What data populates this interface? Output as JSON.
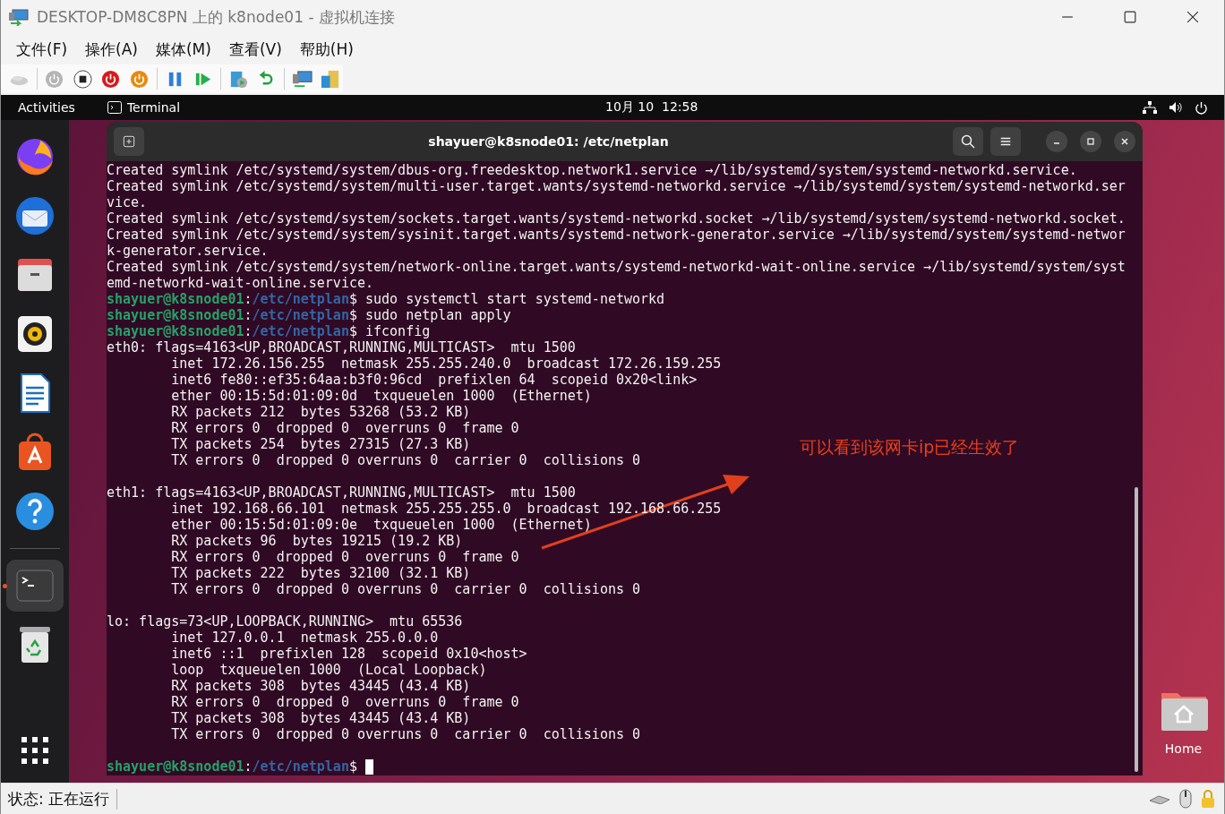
{
  "window": {
    "title": "DESKTOP-DM8C8PN 上的 k8node01 - 虚拟机连接"
  },
  "menu": [
    "文件(F)",
    "操作(A)",
    "媒体(M)",
    "查看(V)",
    "帮助(H)"
  ],
  "toolbar": {
    "groups": [
      {
        "buttons": [
          {
            "kind": "ctrl-alt-del"
          }
        ]
      },
      {
        "buttons": [
          {
            "kind": "start"
          },
          {
            "kind": "turn-off"
          },
          {
            "kind": "shut-down"
          },
          {
            "kind": "save"
          }
        ]
      },
      {
        "buttons": [
          {
            "kind": "pause"
          },
          {
            "kind": "resume"
          }
        ]
      },
      {
        "buttons": [
          {
            "kind": "checkpoint"
          },
          {
            "kind": "revert"
          }
        ]
      },
      {
        "buttons": [
          {
            "kind": "enhanced-session"
          },
          {
            "kind": "share"
          }
        ]
      }
    ]
  },
  "topbar": {
    "activities": "Activities",
    "app": "Terminal",
    "clock": "10月 10  12:58"
  },
  "dock": {
    "items": [
      {
        "kind": "browser",
        "selected": false
      },
      {
        "kind": "mail",
        "selected": false
      },
      {
        "kind": "files",
        "selected": false
      },
      {
        "kind": "music",
        "selected": false
      },
      {
        "kind": "writer",
        "selected": false
      },
      {
        "kind": "store",
        "selected": false
      },
      {
        "kind": "help",
        "selected": false
      },
      {
        "kind": "terminal",
        "selected": true
      },
      {
        "kind": "trash",
        "selected": false
      }
    ]
  },
  "terminal": {
    "title": "shayuer@k8snode01: /etc/netplan",
    "lines": [
      {
        "kind": "output",
        "text": "Created symlink /etc/systemd/system/dbus-org.freedesktop.network1.service →/lib/systemd/system/systemd-networkd.service."
      },
      {
        "kind": "output",
        "text": "Created symlink /etc/systemd/system/multi-user.target.wants/systemd-networkd.service →/lib/systemd/system/systemd-networkd.ser"
      },
      {
        "kind": "output",
        "text": "vice."
      },
      {
        "kind": "output",
        "text": "Created symlink /etc/systemd/system/sockets.target.wants/systemd-networkd.socket →/lib/systemd/system/systemd-networkd.socket."
      },
      {
        "kind": "output",
        "text": "Created symlink /etc/systemd/system/sysinit.target.wants/systemd-network-generator.service →/lib/systemd/system/systemd-networ"
      },
      {
        "kind": "output",
        "text": "k-generator.service."
      },
      {
        "kind": "output",
        "text": "Created symlink /etc/systemd/system/network-online.target.wants/systemd-networkd-wait-online.service →/lib/systemd/system/syst"
      },
      {
        "kind": "output",
        "text": "emd-networkd-wait-online.service."
      },
      {
        "kind": "prompt",
        "user": "shayuer@k8snode01",
        "colon": ":",
        "path": "/etc/netplan",
        "symbol": "$",
        "command": "sudo systemctl start systemd-networkd",
        "cursor": false
      },
      {
        "kind": "prompt",
        "user": "shayuer@k8snode01",
        "colon": ":",
        "path": "/etc/netplan",
        "symbol": "$",
        "command": "sudo netplan apply",
        "cursor": false
      },
      {
        "kind": "prompt",
        "user": "shayuer@k8snode01",
        "colon": ":",
        "path": "/etc/netplan",
        "symbol": "$",
        "command": "ifconfig",
        "cursor": false
      },
      {
        "kind": "output",
        "text": "eth0: flags=4163<UP,BROADCAST,RUNNING,MULTICAST>  mtu 1500"
      },
      {
        "kind": "output",
        "text": "        inet 172.26.156.255  netmask 255.255.240.0  broadcast 172.26.159.255"
      },
      {
        "kind": "output",
        "text": "        inet6 fe80::ef35:64aa:b3f0:96cd  prefixlen 64  scopeid 0x20<link>"
      },
      {
        "kind": "output",
        "text": "        ether 00:15:5d:01:09:0d  txqueuelen 1000  (Ethernet)"
      },
      {
        "kind": "output",
        "text": "        RX packets 212  bytes 53268 (53.2 KB)"
      },
      {
        "kind": "output",
        "text": "        RX errors 0  dropped 0  overruns 0  frame 0"
      },
      {
        "kind": "output",
        "text": "        TX packets 254  bytes 27315 (27.3 KB)"
      },
      {
        "kind": "output",
        "text": "        TX errors 0  dropped 0 overruns 0  carrier 0  collisions 0"
      },
      {
        "kind": "blank"
      },
      {
        "kind": "output",
        "text": "eth1: flags=4163<UP,BROADCAST,RUNNING,MULTICAST>  mtu 1500"
      },
      {
        "kind": "output",
        "text": "        inet 192.168.66.101  netmask 255.255.255.0  broadcast 192.168.66.255"
      },
      {
        "kind": "output",
        "text": "        ether 00:15:5d:01:09:0e  txqueuelen 1000  (Ethernet)"
      },
      {
        "kind": "output",
        "text": "        RX packets 96  bytes 19215 (19.2 KB)"
      },
      {
        "kind": "output",
        "text": "        RX errors 0  dropped 0  overruns 0  frame 0"
      },
      {
        "kind": "output",
        "text": "        TX packets 222  bytes 32100 (32.1 KB)"
      },
      {
        "kind": "output",
        "text": "        TX errors 0  dropped 0 overruns 0  carrier 0  collisions 0"
      },
      {
        "kind": "blank"
      },
      {
        "kind": "output",
        "text": "lo: flags=73<UP,LOOPBACK,RUNNING>  mtu 65536"
      },
      {
        "kind": "output",
        "text": "        inet 127.0.0.1  netmask 255.0.0.0"
      },
      {
        "kind": "output",
        "text": "        inet6 ::1  prefixlen 128  scopeid 0x10<host>"
      },
      {
        "kind": "output",
        "text": "        loop  txqueuelen 1000  (Local Loopback)"
      },
      {
        "kind": "output",
        "text": "        RX packets 308  bytes 43445 (43.4 KB)"
      },
      {
        "kind": "output",
        "text": "        RX errors 0  dropped 0  overruns 0  frame 0"
      },
      {
        "kind": "output",
        "text": "        TX packets 308  bytes 43445 (43.4 KB)"
      },
      {
        "kind": "output",
        "text": "        TX errors 0  dropped 0 overruns 0  carrier 0  collisions 0"
      },
      {
        "kind": "blank"
      },
      {
        "kind": "prompt",
        "user": "shayuer@k8snode01",
        "colon": ":",
        "path": "/etc/netplan",
        "symbol": "$",
        "cursor": true
      }
    ],
    "annotation": {
      "text": "可以看到该网卡ip已经生效了"
    }
  },
  "desktop": {
    "home_label": "Home"
  },
  "status_bar": {
    "text": "状态: 正在运行"
  }
}
